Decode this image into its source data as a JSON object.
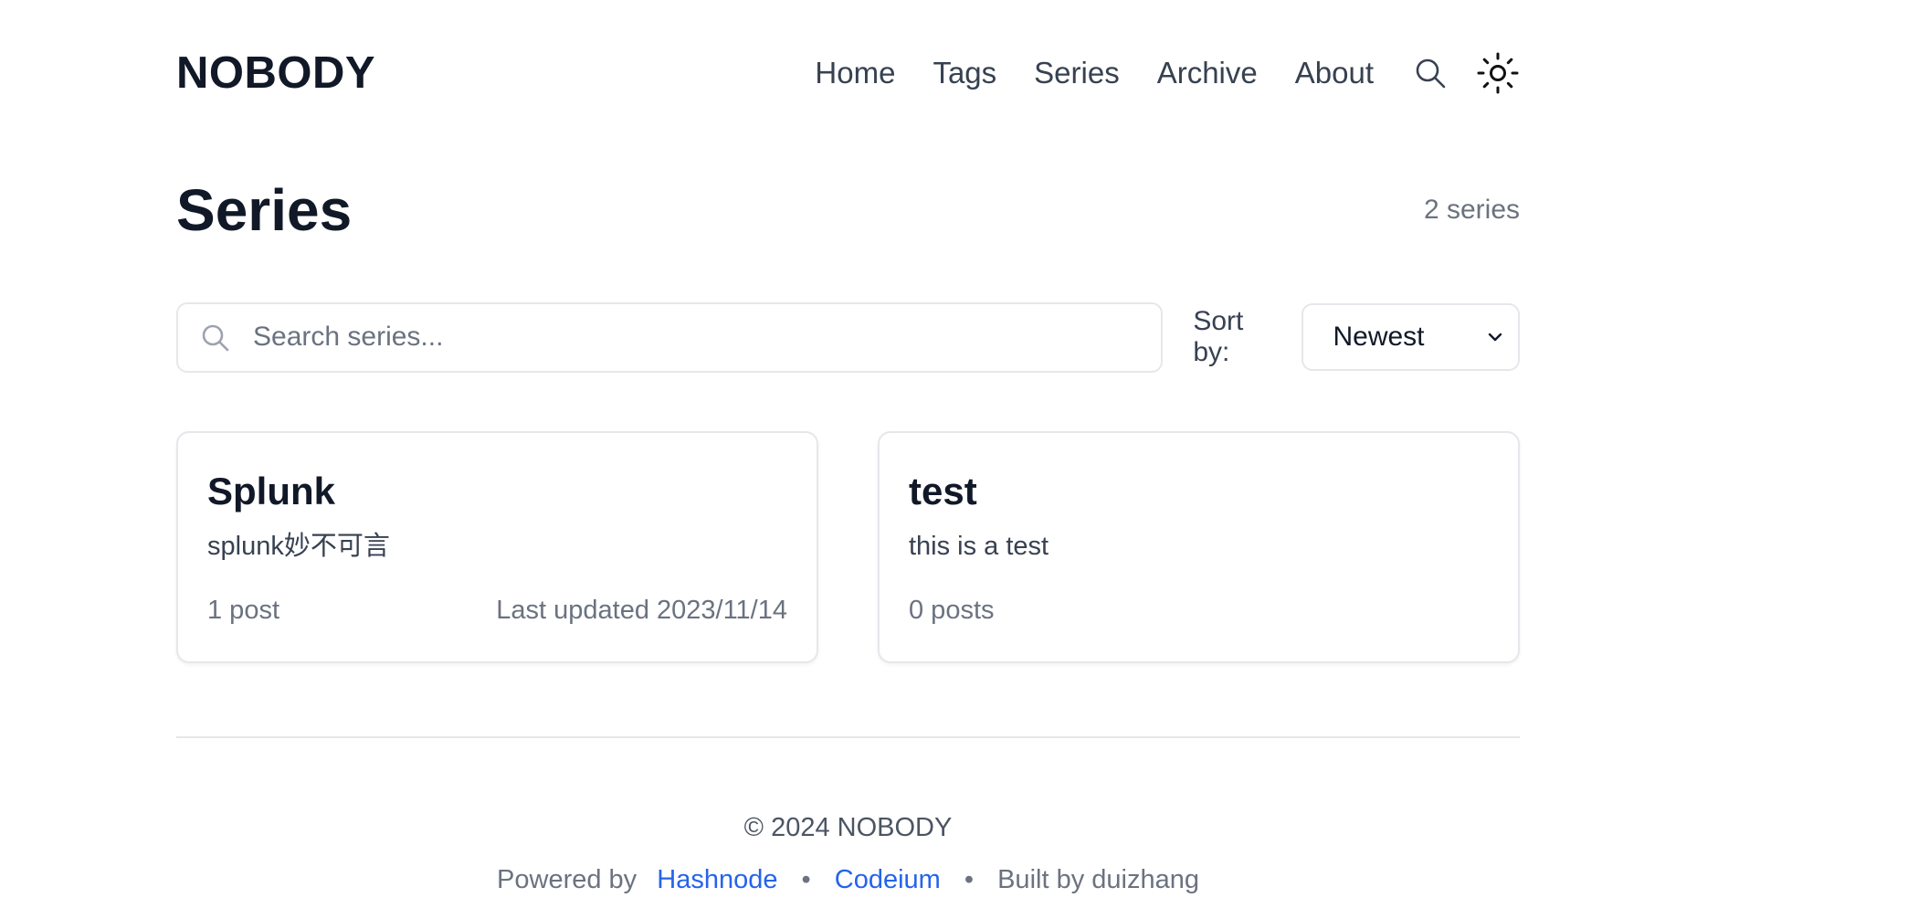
{
  "header": {
    "logo": "NOBODY",
    "nav": [
      {
        "label": "Home"
      },
      {
        "label": "Tags"
      },
      {
        "label": "Series"
      },
      {
        "label": "Archive"
      },
      {
        "label": "About"
      }
    ],
    "search_icon": "search-icon",
    "theme_icon": "sun-icon"
  },
  "page": {
    "title": "Series",
    "count": "2 series"
  },
  "controls": {
    "search_placeholder": "Search series...",
    "search_value": "",
    "sort_label": "Sort by:",
    "sort_value": "Newest"
  },
  "series": [
    {
      "title": "Splunk",
      "description": "splunk妙不可言",
      "posts": "1 post",
      "updated": "Last updated 2023/11/14"
    },
    {
      "title": "test",
      "description": "this is a test",
      "posts": "0 posts",
      "updated": ""
    }
  ],
  "footer": {
    "copyright": "© 2024 NOBODY",
    "powered_by": "Powered by",
    "link_1": "Hashnode",
    "separator": "•",
    "link_2": "Codeium",
    "built_by": "Built by duizhang"
  },
  "colors": {
    "text": "#111827",
    "muted": "#6b7280",
    "border": "#e5e7eb",
    "link": "#2563eb"
  }
}
